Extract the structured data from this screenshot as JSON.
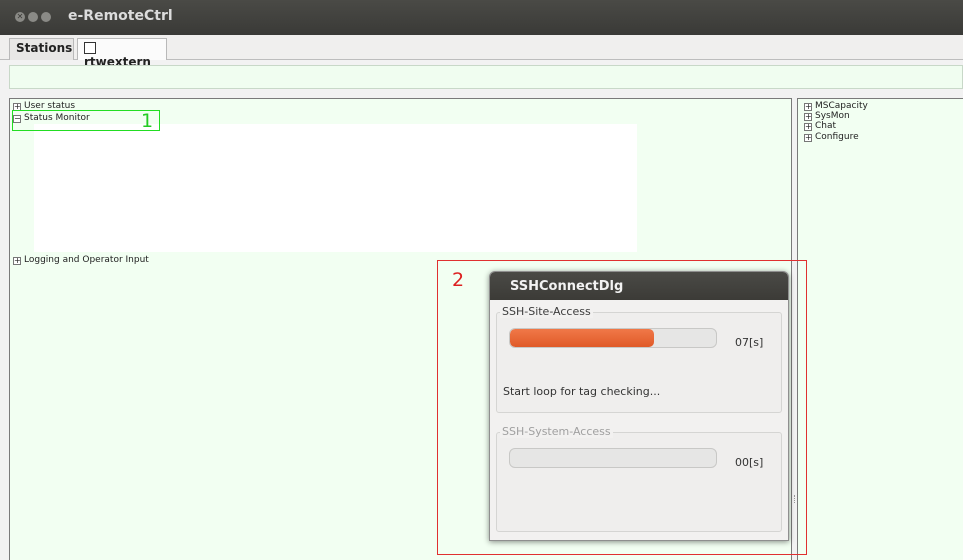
{
  "window": {
    "title": "e-RemoteCtrl"
  },
  "tabs": [
    {
      "label": "Stations"
    },
    {
      "label": "rtwextern"
    }
  ],
  "left_panel": {
    "items": [
      {
        "label": "User status",
        "expander": "+"
      },
      {
        "label": "Status Monitor",
        "expander": "−"
      },
      {
        "label": "Logging and Operator Input",
        "expander": "+"
      }
    ]
  },
  "right_panel": {
    "items": [
      {
        "label": "MSCapacity",
        "expander": "+"
      },
      {
        "label": "SysMon",
        "expander": "+"
      },
      {
        "label": "Chat",
        "expander": "+"
      },
      {
        "label": "Configure",
        "expander": "+"
      }
    ]
  },
  "annotations": {
    "label_1": "1",
    "label_2": "2",
    "color_1": "#22cc22",
    "color_2": "#dd2020"
  },
  "dialog": {
    "title": "SSHConnectDlg",
    "site_group": {
      "label": "SSH-Site-Access",
      "progress": 0.7,
      "timer": "07[s]",
      "status": "Start loop for tag checking..."
    },
    "system_group": {
      "label": "SSH-System-Access",
      "progress": 0.0,
      "timer": "00[s]"
    }
  },
  "colors": {
    "titlebar": "#3c3b37",
    "progress_accent": "#e8643a",
    "panel_bg": "#f2fff2"
  }
}
